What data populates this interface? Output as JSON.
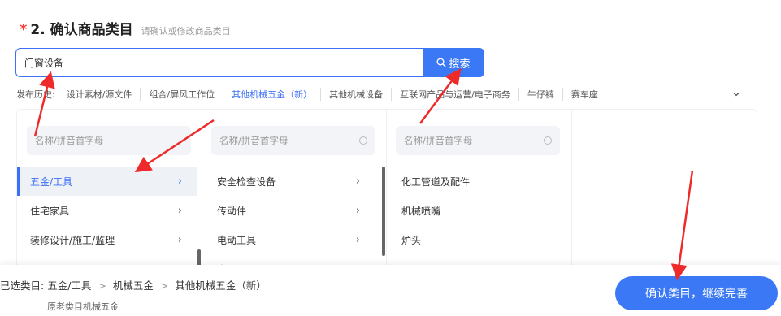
{
  "header": {
    "required_mark": "*",
    "title": "2. 确认商品类目",
    "subtitle": "请确认或修改商品类目"
  },
  "search": {
    "value": "门窗设备",
    "button_label": "搜索",
    "button_icon": "search-icon"
  },
  "history": {
    "label": "发布历史:",
    "items": [
      "设计素材/源文件",
      "组合/屏风工作位",
      "其他机械五金（新）",
      "其他机械设备",
      "互联网产品与运营/电子商务",
      "牛仔裤",
      "赛车座"
    ],
    "active_index": 2,
    "more_icon": "chevron-down-icon"
  },
  "columns": [
    {
      "search_placeholder": "名称/拼音首字母",
      "items": [
        {
          "label": "五金/工具",
          "selected": true
        },
        {
          "label": "住宅家具",
          "selected": false
        },
        {
          "label": "装修设计/施工/监理",
          "selected": false
        }
      ]
    },
    {
      "search_placeholder": "名称/拼音首字母",
      "items": [
        {
          "label": "安全检查设备",
          "selected": false
        },
        {
          "label": "传动件",
          "selected": false
        },
        {
          "label": "电动工具",
          "selected": false
        },
        {
          "label": "电子仪器",
          "selected": false
        }
      ]
    },
    {
      "search_placeholder": "名称/拼音首字母",
      "items": [
        {
          "label": "化工管道及配件",
          "selected": false
        },
        {
          "label": "机械喷嘴",
          "selected": false
        },
        {
          "label": "炉头",
          "selected": false
        }
      ]
    }
  ],
  "footer": {
    "selected_label": "已选类目:",
    "path": [
      "五金/工具",
      "机械五金",
      "其他机械五金（新）"
    ],
    "path_separator": ">",
    "original": "原老类目机械五金",
    "confirm_label": "确认类目，继续完善"
  },
  "colors": {
    "accent": "#3b78f5",
    "required": "#ff3b30",
    "annotation_arrow": "#ee2a2a"
  }
}
